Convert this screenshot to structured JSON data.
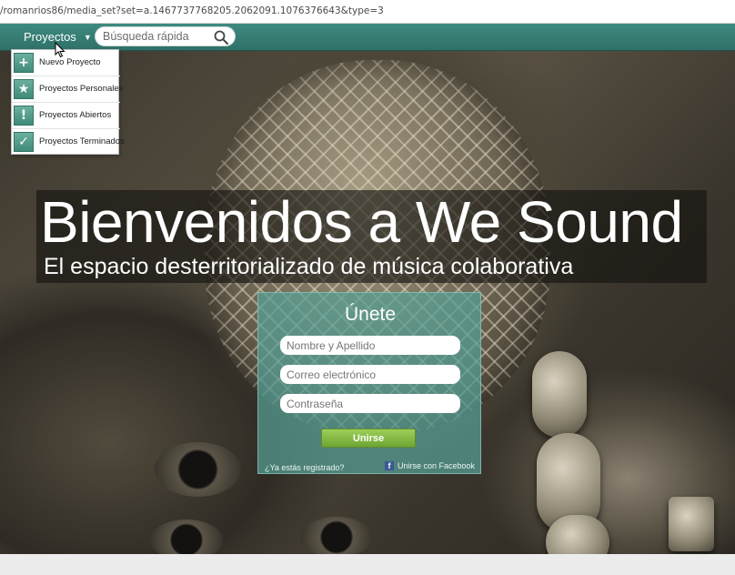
{
  "browser": {
    "url": "/romanrios86/media_set?set=a.1467737768205.2062091.1076376643&type=3"
  },
  "nav": {
    "projects_label": "Proyectos",
    "chevron_icon": "chevron-down-icon",
    "search_placeholder": "Búsqueda rápida",
    "search_icon": "search-icon"
  },
  "dropdown": {
    "items": [
      {
        "label": "Nuevo Proyecto",
        "icon": "+",
        "icon_name": "plus-icon"
      },
      {
        "label": "Proyectos Personales",
        "icon": "★",
        "icon_name": "star-icon"
      },
      {
        "label": "Proyectos Abiertos",
        "icon": "!",
        "icon_name": "exclamation-icon"
      },
      {
        "label": "Proyectos Terminados",
        "icon": "✓",
        "icon_name": "checkmark-icon"
      }
    ]
  },
  "hero": {
    "title": "Bienvenidos a We Sound",
    "subtitle": "El espacio desterritorializado de música colaborativa"
  },
  "signup": {
    "heading": "Únete",
    "name_placeholder": "Nombre y Apellido",
    "email_placeholder": "Correo electrónico",
    "password_placeholder": "Contraseña",
    "submit_label": "Unirse",
    "registered_link": "¿Ya estás registrado?",
    "facebook_link": "Unirse con Facebook",
    "facebook_icon": "facebook-icon"
  },
  "colors": {
    "nav_teal": "#347b71",
    "panel_teal": "#56a096",
    "button_green": "#7fb842",
    "facebook_blue": "#3b5998"
  }
}
